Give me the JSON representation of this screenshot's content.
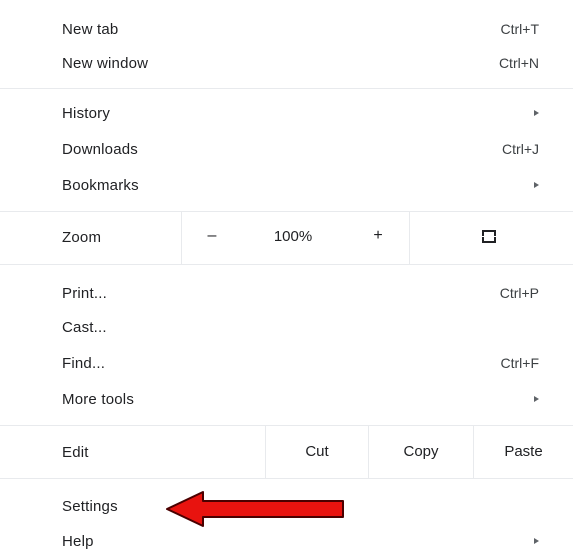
{
  "menu": {
    "new_tab": {
      "label": "New tab",
      "shortcut": "Ctrl+T"
    },
    "new_window": {
      "label": "New window",
      "shortcut": "Ctrl+N"
    },
    "history": {
      "label": "History"
    },
    "downloads": {
      "label": "Downloads",
      "shortcut": "Ctrl+J"
    },
    "bookmarks": {
      "label": "Bookmarks"
    },
    "zoom": {
      "label": "Zoom",
      "minus": "–",
      "level": "100%",
      "plus": "+"
    },
    "print": {
      "label": "Print...",
      "shortcut": "Ctrl+P"
    },
    "cast": {
      "label": "Cast..."
    },
    "find": {
      "label": "Find...",
      "shortcut": "Ctrl+F"
    },
    "more_tools": {
      "label": "More tools"
    },
    "edit": {
      "label": "Edit",
      "cut": "Cut",
      "copy": "Copy",
      "paste": "Paste"
    },
    "settings": {
      "label": "Settings"
    },
    "help": {
      "label": "Help"
    }
  },
  "icons": {
    "submenu": "submenu-arrow-icon",
    "fullscreen": "fullscreen-icon",
    "annotation": "red-arrow-annotation"
  },
  "colors": {
    "annotation_arrow": "#e8130f"
  }
}
